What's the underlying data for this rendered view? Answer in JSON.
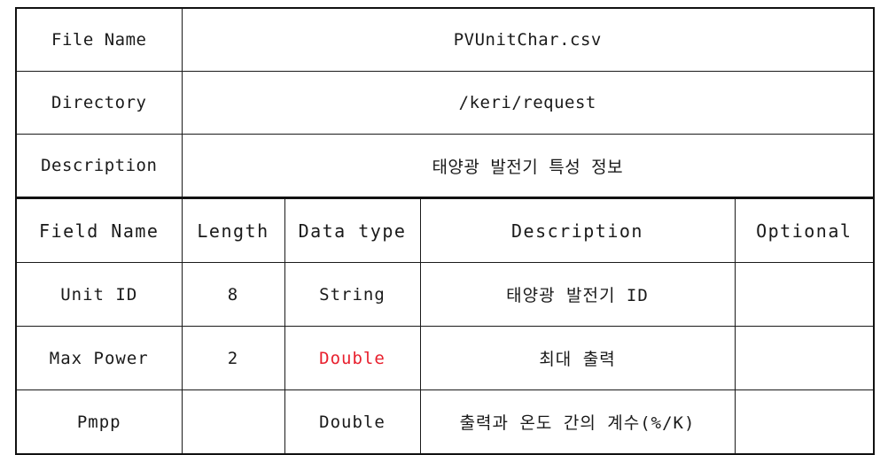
{
  "document": {
    "type": "file-specification-table",
    "meta_rows": [
      {
        "label": "File Name",
        "value": "PVUnitChar.csv"
      },
      {
        "label": "Directory",
        "value": "/keri/request"
      },
      {
        "label": "Description",
        "value": "태양광 발전기 특성 정보"
      }
    ],
    "field_table": {
      "headers": [
        "Field Name",
        "Length",
        "Data type",
        "Description",
        "Optional"
      ],
      "rows": [
        {
          "field_name": "Unit ID",
          "length": "8",
          "data_type": "String",
          "data_type_color": "#1a1a1a",
          "description": "태양광 발전기 ID",
          "optional": ""
        },
        {
          "field_name": "Max Power",
          "length": "2",
          "data_type": "Double",
          "data_type_color": "#e8202e",
          "description": "최대 출력",
          "optional": ""
        },
        {
          "field_name": "Pmpp",
          "length": "",
          "data_type": "Double",
          "data_type_color": "#1a1a1a",
          "description": "출력과 온도 간의 계수(%/K)",
          "optional": ""
        }
      ]
    }
  }
}
